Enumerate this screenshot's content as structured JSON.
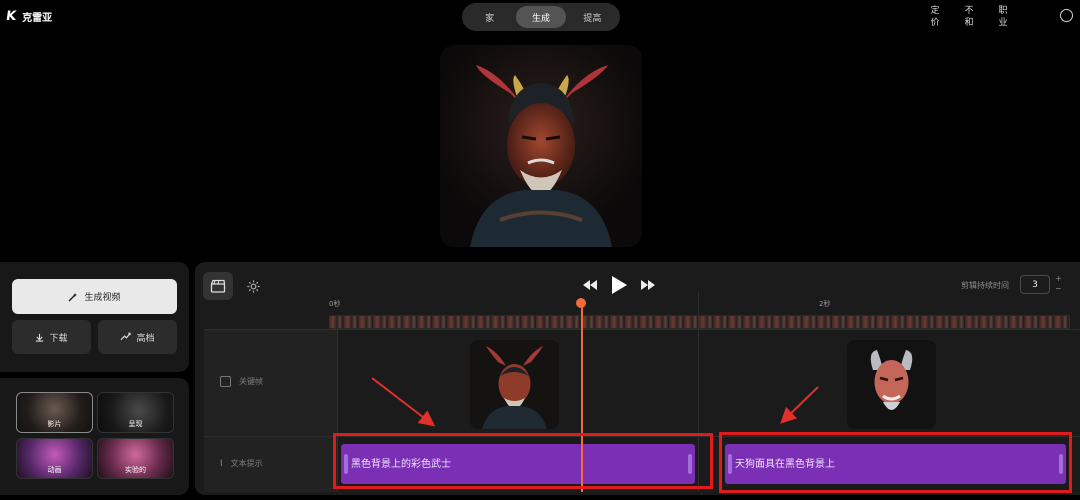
{
  "app": {
    "logo_glyph": "K",
    "name": "克雷亚"
  },
  "tabs": [
    {
      "label": "家",
      "active": false
    },
    {
      "label": "生成",
      "active": true
    },
    {
      "label": "提高",
      "active": false
    }
  ],
  "topnav": {
    "pricing": [
      "定",
      "价"
    ],
    "unknown": [
      "不",
      "和"
    ],
    "careers": [
      "职",
      "业"
    ]
  },
  "left": {
    "generate_label": "生成视频",
    "download_label": "下载",
    "upscale_label": "高档",
    "styles": [
      {
        "label": "影片",
        "selected": true
      },
      {
        "label": "呈现",
        "selected": false
      },
      {
        "label": "动画",
        "selected": false
      },
      {
        "label": "实验的",
        "selected": false
      }
    ]
  },
  "timeline": {
    "duration_label": "剪辑持续时间",
    "duration_value": "3",
    "ruler": [
      "0秒",
      "2秒"
    ],
    "rows": {
      "keyframe_label": "关键帧",
      "text_label": "文本提示"
    },
    "clips": [
      {
        "text": "黑色背景上的彩色武士"
      },
      {
        "text": "天狗面具在黑色背景上"
      }
    ],
    "playhead_fraction": 0.35
  },
  "colors": {
    "accent_purple": "#7b2fb5",
    "playhead": "#f26b3a",
    "highlight_red": "#e01b1b",
    "arrow_red": "#e0302a"
  }
}
